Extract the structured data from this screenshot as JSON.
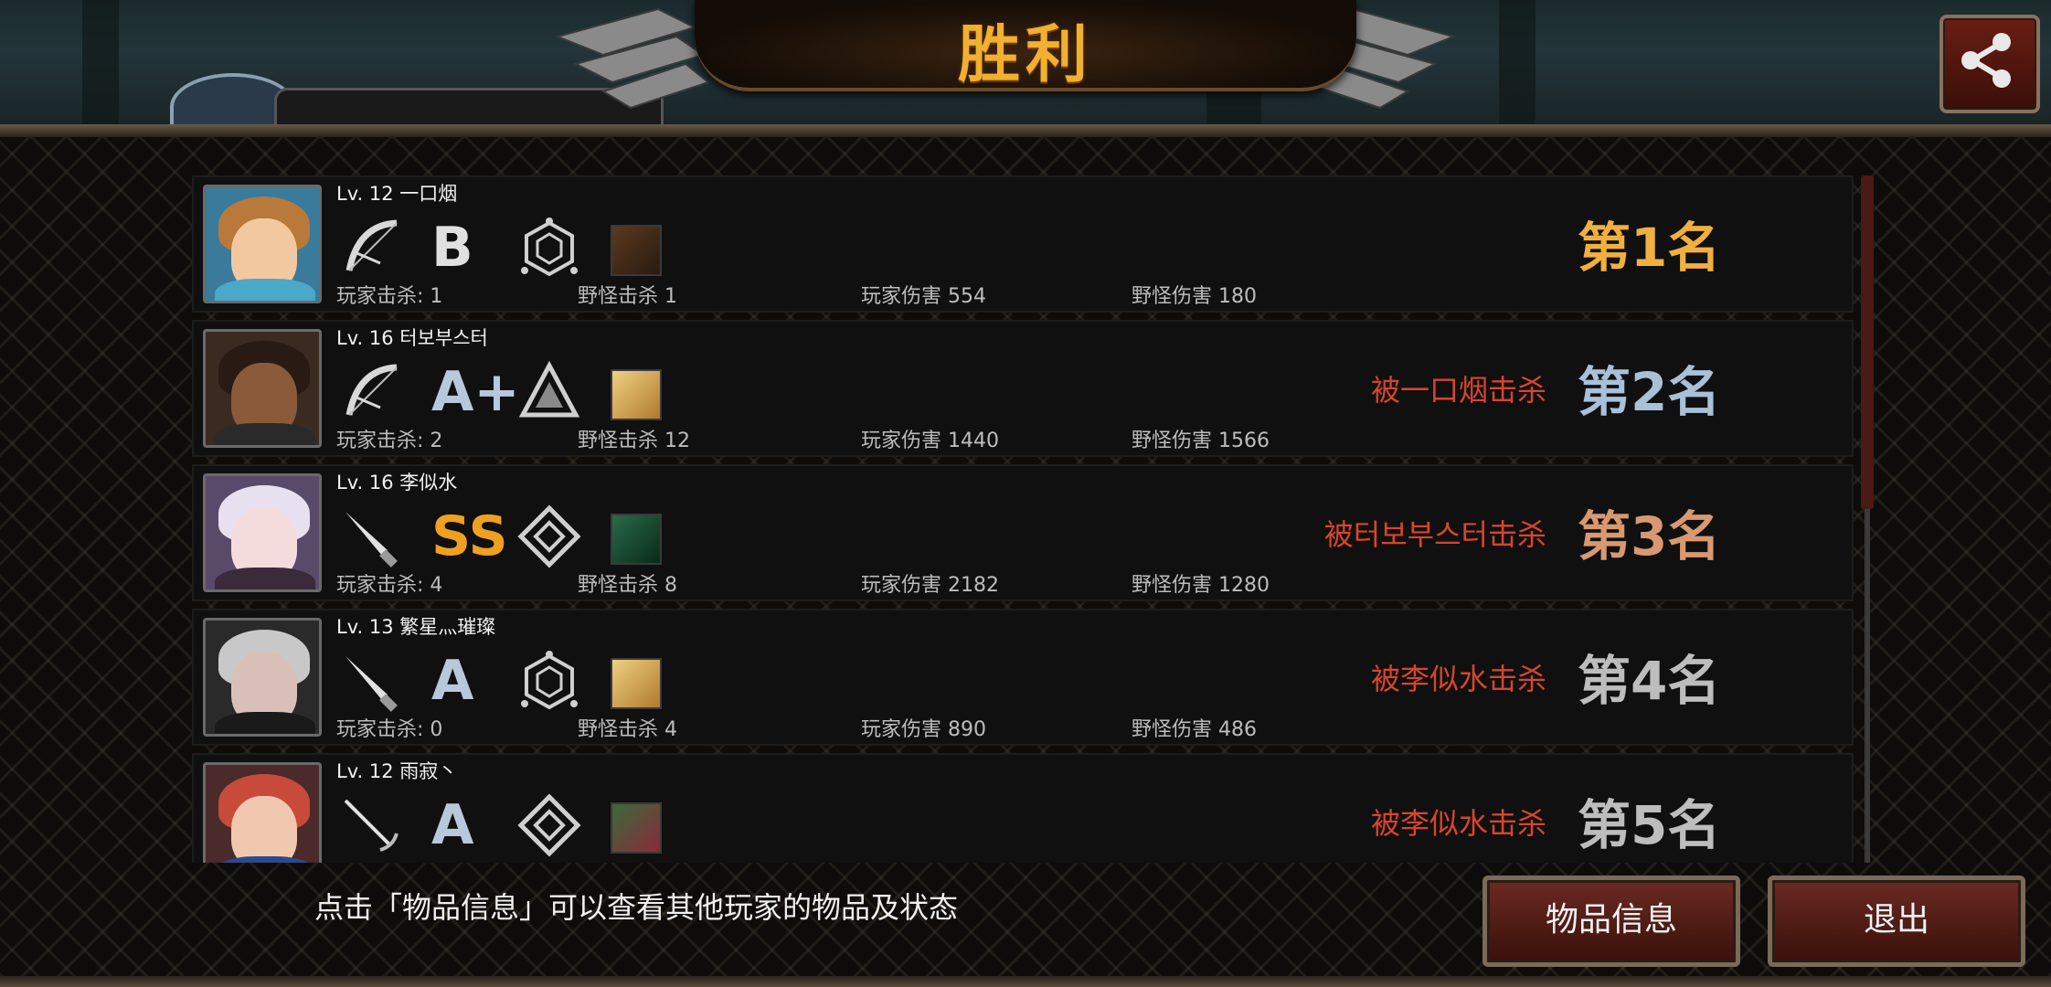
{
  "title": "胜利",
  "hint_text": "点击「物品信息」可以查看其他玩家的物品及状态",
  "buttons": {
    "items": "物品信息",
    "exit": "退出"
  },
  "colors": {
    "title": "#f0b030",
    "killed_by": "#d8452c",
    "place_1": "#f0b040",
    "place_2": "#a8c0d8",
    "place_3": "#d89870",
    "place_other": "#bdbdbd"
  },
  "players": [
    {
      "level_name": "Lv. 12 一口烟",
      "weapon": "bow-icon",
      "grade": "B",
      "rank_icon": "hexagon-rank-icon",
      "item": "item-icon",
      "player_kills": "玩家击杀: 1",
      "monster_kills": "野怪击杀 1",
      "player_damage": "玩家伤害 554",
      "monster_damage": "野怪伤害 180",
      "killed_by": "",
      "place": "第1名"
    },
    {
      "level_name": "Lv. 16 터보부스터",
      "weapon": "bow-icon",
      "grade": "A+",
      "rank_icon": "triangle-rank-icon",
      "item": "item-icon",
      "player_kills": "玩家击杀: 2",
      "monster_kills": "野怪击杀 12",
      "player_damage": "玩家伤害 1440",
      "monster_damage": "野怪伤害 1566",
      "killed_by": "被一口烟击杀",
      "place": "第2名"
    },
    {
      "level_name": "Lv. 16 李似水",
      "weapon": "knife-icon",
      "grade": "SS",
      "rank_icon": "diamond-rank-icon",
      "item": "item-icon",
      "player_kills": "玩家击杀: 4",
      "monster_kills": "野怪击杀 8",
      "player_damage": "玩家伤害 2182",
      "monster_damage": "野怪伤害 1280",
      "killed_by": "被터보부스터击杀",
      "place": "第3名"
    },
    {
      "level_name": "Lv. 13 繁星灬璀璨",
      "weapon": "knife-icon",
      "grade": "A",
      "rank_icon": "hexagon-rank-icon",
      "item": "item-icon",
      "player_kills": "玩家击杀: 0",
      "monster_kills": "野怪击杀 4",
      "player_damage": "玩家伤害 890",
      "monster_damage": "野怪伤害 486",
      "killed_by": "被李似水击杀",
      "place": "第4名"
    },
    {
      "level_name": "Lv. 12 雨寂丶",
      "weapon": "rapier-icon",
      "grade": "A",
      "rank_icon": "diamond-rank-icon",
      "item": "item-icon",
      "player_kills": "",
      "monster_kills": "",
      "player_damage": "",
      "monster_damage": "",
      "killed_by": "被李似水击杀",
      "place": "第5名"
    }
  ]
}
